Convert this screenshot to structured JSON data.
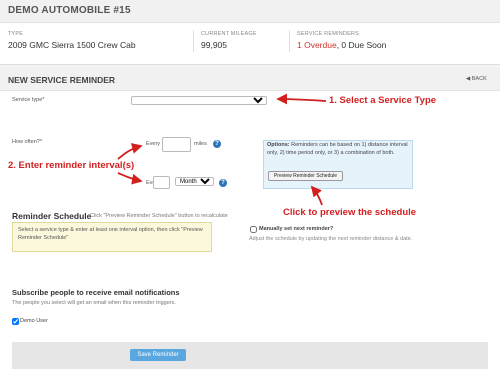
{
  "vehicle": {
    "title": "DEMO AUTOMOBILE #15",
    "type_label": "TYPE",
    "type_value": "2009 GMC Sierra 1500 Crew Cab",
    "mileage_label": "CURRENT MILEAGE",
    "mileage_value": "99,905",
    "reminders_label": "SERVICE REMINDERS",
    "overdue": "1 Overdue",
    "due_soon": ", 0 Due Soon"
  },
  "form": {
    "title": "NEW SERVICE REMINDER",
    "back_label": "BACK",
    "service_type_label": "Service type*",
    "service_type_value": "",
    "how_often_label": "How often?*",
    "every_label_1": "Every",
    "miles_unit": "miles",
    "every_label_2": "Every",
    "period_value": "Month(s)",
    "options_bold": "Options:",
    "options_text": " Reminders can be based on 1) distance interval only, 2) time period only, or 3) a combination of both.",
    "preview_button": "Preview Reminder Schedule",
    "schedule_title": "Reminder Schedule",
    "schedule_hint": "Click \"Preview Reminder Schedule\" button to recalculate",
    "notice_text": "Select a service type & enter at least one interval option, then click \"Preview Reminder Schedule\"",
    "manual_label": "Manually set next reminder?",
    "manual_sub": "Adjust the schedule by updating the next reminder distance & date.",
    "subscribe_title": "Subscribe people to receive email notifications",
    "subscribe_sub": "The people you select will get an email when this reminder triggers.",
    "demo_user": "Demo User",
    "demo_user_checked": true,
    "save_button": "Save Reminder"
  },
  "annotations": {
    "step1": "1. Select a Service Type",
    "step2": "2. Enter reminder interval(s)",
    "step3": "Click to preview the schedule"
  },
  "colors": {
    "annotation_red": "#d21f1f",
    "overdue_red": "#d0352b",
    "accent_blue": "#5aa7e0"
  }
}
